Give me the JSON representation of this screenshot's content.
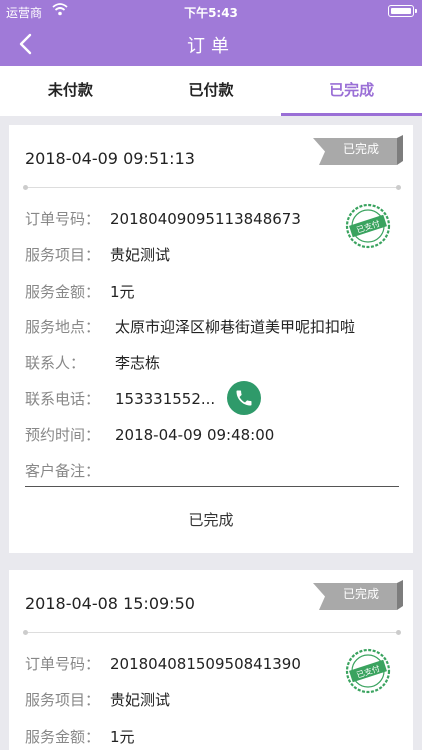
{
  "status_bar": {
    "carrier": "运营商",
    "time": "下午5:43"
  },
  "nav": {
    "title": "订单"
  },
  "tabs": [
    {
      "label": "未付款",
      "active": false
    },
    {
      "label": "已付款",
      "active": false
    },
    {
      "label": "已完成",
      "active": true
    }
  ],
  "orders": [
    {
      "time": "2018-04-09 09:51:13",
      "badge": "已完成",
      "stamp": "已支付",
      "fields": [
        {
          "label": "订单号码：",
          "value": "20180409095113848673"
        },
        {
          "label": "服务项目：",
          "value": "贵妃测试"
        },
        {
          "label": "服务金额：",
          "value": "1元"
        },
        {
          "label": "服务地点：",
          "value": "太原市迎泽区柳巷街道美甲呢扣扣啦"
        },
        {
          "label": "联系人：",
          "value": "李志栋"
        },
        {
          "label": "联系电话：",
          "value": "153331552..."
        },
        {
          "label": "预约时间：",
          "value": "2018-04-09 09:48:00"
        },
        {
          "label": "客户备注：",
          "value": ""
        }
      ],
      "status": "已完成"
    },
    {
      "time": "2018-04-08 15:09:50",
      "badge": "已完成",
      "stamp": "已支付",
      "fields": [
        {
          "label": "订单号码：",
          "value": "20180408150950841390"
        },
        {
          "label": "服务项目：",
          "value": "贵妃测试"
        },
        {
          "label": "服务金额：",
          "value": "1元"
        }
      ]
    }
  ],
  "colors": {
    "accent": "#9a6fd6",
    "header": "#a07ad8",
    "phone": "#2f9a6a",
    "stamp": "#3aa35f"
  }
}
